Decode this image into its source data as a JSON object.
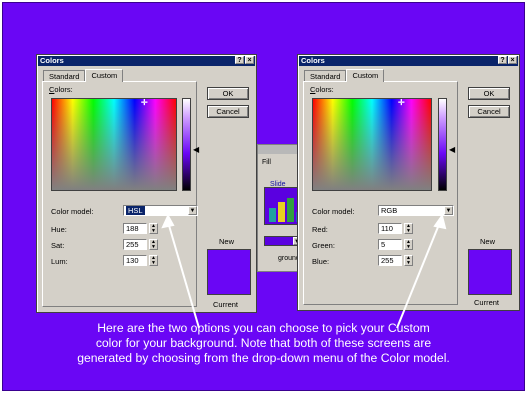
{
  "caption": {
    "line1": "Here are the two options you can choose to pick your Custom",
    "line2": "color for your background. Note that both of these screens are",
    "line3": "generated by choosing from the drop-down menu of the Color model."
  },
  "background_dialog": {
    "fill_label": "Fill",
    "slide_label": "Slide",
    "ground_text": "ground gra"
  },
  "left_dialog": {
    "title": "Colors",
    "help": "?",
    "close": "×",
    "tabs": [
      "Standard",
      "Custom"
    ],
    "colors_label": "Colors:",
    "color_model_label": "Color model:",
    "color_model_value": "HSL",
    "fields": [
      {
        "label": "Hue:",
        "value": "188"
      },
      {
        "label": "Sat:",
        "value": "255"
      },
      {
        "label": "Lum:",
        "value": "130"
      }
    ],
    "ok": "OK",
    "cancel": "Cancel",
    "new_label": "New",
    "current_label": "Current",
    "selected_color": "#6a06f5"
  },
  "right_dialog": {
    "title": "Colors",
    "help": "?",
    "close": "×",
    "tabs": [
      "Standard",
      "Custom"
    ],
    "colors_label": "Colors:",
    "color_model_label": "Color model:",
    "color_model_value": "RGB",
    "fields": [
      {
        "label": "Red:",
        "value": "110"
      },
      {
        "label": "Green:",
        "value": "5"
      },
      {
        "label": "Blue:",
        "value": "255"
      }
    ],
    "ok": "OK",
    "cancel": "Cancel",
    "new_label": "New",
    "current_label": "Current",
    "selected_color": "#6a06f5"
  }
}
